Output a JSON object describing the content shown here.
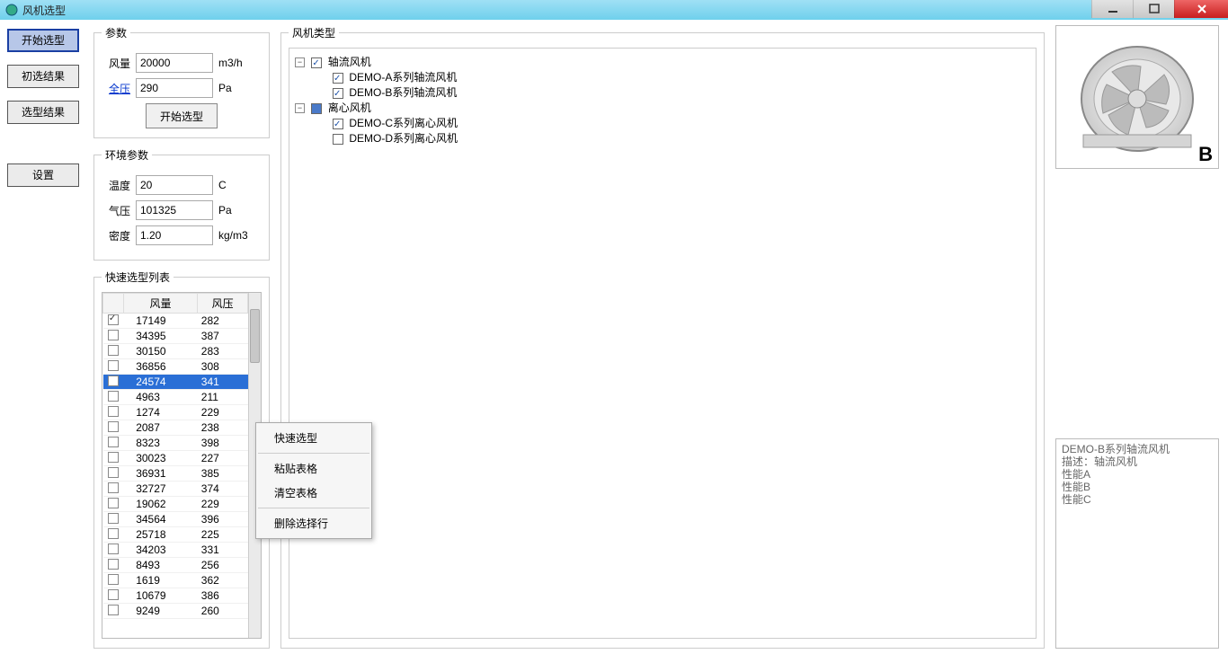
{
  "window": {
    "title": "风机选型"
  },
  "nav": {
    "start": "开始选型",
    "prelim": "初选结果",
    "result": "选型结果",
    "settings": "设置"
  },
  "params": {
    "legend": "参数",
    "airflow_lbl": "风量",
    "airflow_val": "20000",
    "airflow_unit": "m3/h",
    "pressure_lbl": "全压",
    "pressure_val": "290",
    "pressure_unit": "Pa",
    "start_btn": "开始选型"
  },
  "env": {
    "legend": "环境参数",
    "temp_lbl": "温度",
    "temp_val": "20",
    "temp_unit": "C",
    "press_lbl": "气压",
    "press_val": "101325",
    "press_unit": "Pa",
    "density_lbl": "密度",
    "density_val": "1.20",
    "density_unit": "kg/m3"
  },
  "quick": {
    "legend": "快速选型列表",
    "col1": "风量",
    "col2": "风压",
    "rows": [
      {
        "c": true,
        "a": "17149",
        "p": "282"
      },
      {
        "c": false,
        "a": "34395",
        "p": "387"
      },
      {
        "c": false,
        "a": "30150",
        "p": "283"
      },
      {
        "c": false,
        "a": "36856",
        "p": "308"
      },
      {
        "c": false,
        "a": "24574",
        "p": "341",
        "sel": true
      },
      {
        "c": false,
        "a": "4963",
        "p": "211"
      },
      {
        "c": false,
        "a": "1274",
        "p": "229"
      },
      {
        "c": false,
        "a": "2087",
        "p": "238"
      },
      {
        "c": false,
        "a": "8323",
        "p": "398"
      },
      {
        "c": false,
        "a": "30023",
        "p": "227"
      },
      {
        "c": false,
        "a": "36931",
        "p": "385"
      },
      {
        "c": false,
        "a": "32727",
        "p": "374"
      },
      {
        "c": false,
        "a": "19062",
        "p": "229"
      },
      {
        "c": false,
        "a": "34564",
        "p": "396"
      },
      {
        "c": false,
        "a": "25718",
        "p": "225"
      },
      {
        "c": false,
        "a": "34203",
        "p": "331"
      },
      {
        "c": false,
        "a": "8493",
        "p": "256"
      },
      {
        "c": false,
        "a": "1619",
        "p": "362"
      },
      {
        "c": false,
        "a": "10679",
        "p": "386"
      },
      {
        "c": false,
        "a": "9249",
        "p": "260"
      }
    ]
  },
  "tree": {
    "legend": "风机类型",
    "axial": "轴流风机",
    "axial_a": "DEMO-A系列轴流风机",
    "axial_b": "DEMO-B系列轴流风机",
    "centrif": "离心风机",
    "centrif_c": "DEMO-C系列离心风机",
    "centrif_d": "DEMO-D系列离心风机"
  },
  "preview": {
    "letter": "B",
    "info_line1": "DEMO-B系列轴流风机",
    "info_line2": "描述：轴流风机",
    "info_line3": "性能A",
    "info_line4": "性能B",
    "info_line5": "性能C"
  },
  "ctx": {
    "quick": "快速选型",
    "paste": "粘贴表格",
    "clear": "清空表格",
    "delete": "删除选择行"
  }
}
